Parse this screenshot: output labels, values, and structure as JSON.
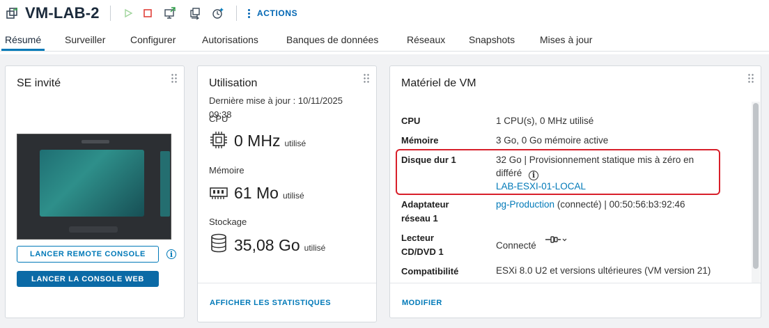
{
  "header": {
    "title": "VM-LAB-2",
    "actions_label": "ACTIONS",
    "icons": [
      "vm-icon",
      "power-on-icon",
      "power-off-icon",
      "launch-console-icon",
      "migrate-icon",
      "snapshot-icon",
      "more-actions-icon"
    ]
  },
  "tabs": [
    {
      "label": "Résumé",
      "active": true
    },
    {
      "label": "Surveiller"
    },
    {
      "label": "Configurer"
    },
    {
      "label": "Autorisations"
    },
    {
      "label": "Banques de données"
    },
    {
      "label": "Réseaux"
    },
    {
      "label": "Snapshots"
    },
    {
      "label": "Mises à jour"
    }
  ],
  "guest_os": {
    "title": "SE invité",
    "remote_console_button": "LANCER REMOTE CONSOLE",
    "web_console_button": "LANCER LA CONSOLE WEB",
    "info_icon": "i"
  },
  "usage": {
    "title": "Utilisation",
    "last_update": "Dernière mise à jour : 10/11/2025 09:38",
    "cpu_label": "CPU",
    "cpu_value": "0 MHz",
    "cpu_suffix": "utilisé",
    "memory_label": "Mémoire",
    "memory_value": "61 Mo",
    "memory_suffix": "utilisé",
    "storage_label": "Stockage",
    "storage_value": "35,08 Go",
    "storage_suffix": "utilisé",
    "stats_link": "AFFICHER LES STATISTIQUES"
  },
  "hardware": {
    "title": "Matériel de VM",
    "rows": [
      {
        "label": "CPU",
        "value": "1 CPU(s), 0 MHz utilisé"
      },
      {
        "label": "Mémoire",
        "value": "3 Go, 0 Go mémoire active"
      },
      {
        "label": "Disque dur 1",
        "value_line1": "32 Go | Provisionnement statique mis à zéro en",
        "value_line2": "différé",
        "link": "LAB-ESXI-01-LOCAL"
      },
      {
        "label_line1": "Adaptateur",
        "label_line2": "réseau 1",
        "link": "pg-Production",
        "value": "(connecté) | 00:50:56:b3:92:46"
      },
      {
        "label_line1": "Lecteur",
        "label_line2": "CD/DVD 1",
        "value": "Connecté"
      },
      {
        "label": "Compatibilité",
        "value": "ESXi 8.0 U2 et versions ultérieures (VM version 21)"
      }
    ],
    "modify_link": "MODIFIER",
    "highlight_color": "#d81f2a"
  },
  "colors": {
    "accent": "#0079b8",
    "button": "#0b6aa6"
  }
}
